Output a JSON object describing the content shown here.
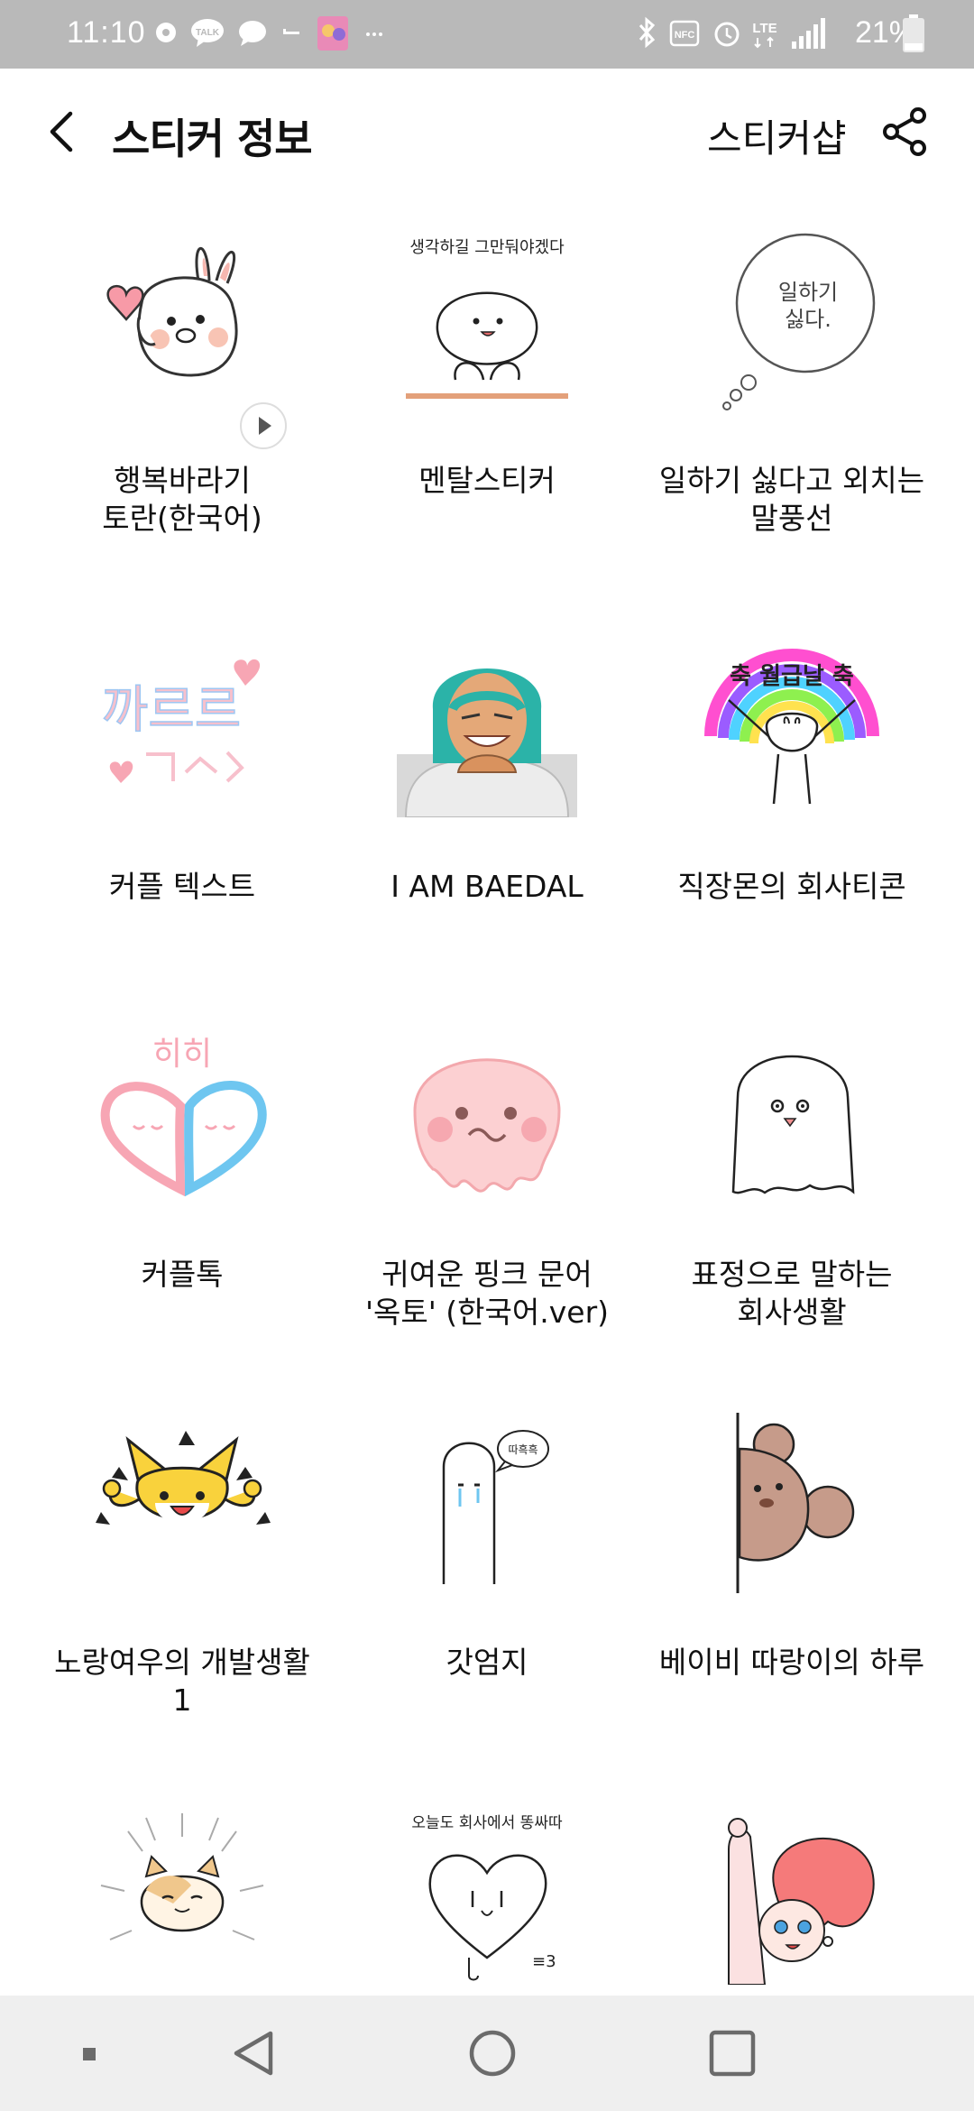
{
  "status_bar": {
    "time": "11:10",
    "battery_percent": "21%",
    "network": "LTE",
    "left_icons": [
      "location-icon",
      "talk-icon",
      "chat-bubble-icon",
      "dash-icon",
      "app-avatar-icon",
      "more-dots-icon"
    ],
    "right_icons": [
      "bluetooth-icon",
      "nfc-icon",
      "alarm-icon",
      "lte-icon",
      "signal-icon",
      "battery-icon"
    ]
  },
  "header": {
    "title": "스티커 정보",
    "shop_label": "스티커샵",
    "back_icon": "chevron-left-icon",
    "share_icon": "share-icon"
  },
  "stickers": [
    {
      "caption": "행복바라기\n토란(한국어)",
      "icon": "bunny-heart-sticker",
      "animated": true
    },
    {
      "caption": "멘탈스티커",
      "icon": "mental-face-sticker",
      "thumb_text": "생각하길 그만둬야겠다"
    },
    {
      "caption": "일하기 싫다고 외치는\n말풍선",
      "icon": "speech-bubble-sticker",
      "thumb_text": "일하기\n싫다."
    },
    {
      "caption": "커플 텍스트",
      "icon": "couple-text-sticker",
      "thumb_text": "까르르"
    },
    {
      "caption": "I AM BAEDAL",
      "icon": "delivery-man-sticker"
    },
    {
      "caption": "직장몬의 회사티콘",
      "icon": "payday-rainbow-sticker",
      "thumb_text": "축 월급날 축"
    },
    {
      "caption": "커플톡",
      "icon": "couple-hearts-sticker",
      "thumb_text": "히히"
    },
    {
      "caption": "귀여운 핑크 문어\n'옥토' (한국어.ver)",
      "icon": "pink-octopus-sticker"
    },
    {
      "caption": "표정으로 말하는\n회사생활",
      "icon": "ghost-face-sticker"
    },
    {
      "caption": "노랑여우의 개발생활\n1",
      "icon": "yellow-fox-sticker"
    },
    {
      "caption": "갓엄지",
      "icon": "thumb-character-sticker",
      "thumb_text": "따흑흑"
    },
    {
      "caption": "베이비 따랑이의 하루",
      "icon": "baby-mouse-sticker"
    },
    {
      "caption": "",
      "icon": "cat-sticker"
    },
    {
      "caption": "",
      "icon": "heart-character-sticker",
      "thumb_text": "오늘도 회사에서 똥싸따"
    },
    {
      "caption": "",
      "icon": "red-hair-girl-sticker"
    }
  ],
  "nav_bar": {
    "items": [
      "recent-apps-dot-icon",
      "back-triangle-icon",
      "home-circle-icon",
      "overview-square-icon"
    ]
  },
  "colors": {
    "status_bar_bg": "#b9b9b9",
    "nav_bar_bg": "#efefef",
    "text": "#111111",
    "pink": "#f7a6b4",
    "blue": "#6ec6f0",
    "teal": "#2bb3a8",
    "yellow": "#f9d23c"
  }
}
